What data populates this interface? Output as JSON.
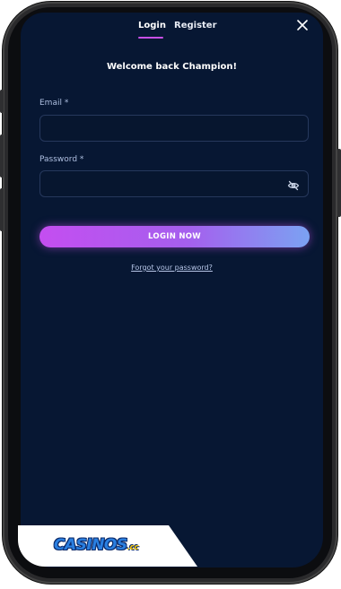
{
  "tabs": [
    {
      "label": "Login",
      "active": true
    },
    {
      "label": "Register",
      "active": false
    }
  ],
  "icons": {
    "close": "close-icon",
    "password_toggle": "eye-off-icon"
  },
  "title": "Welcome back Champion!",
  "form": {
    "email": {
      "label": "Email *",
      "value": "",
      "placeholder": ""
    },
    "password": {
      "label": "Password *",
      "value": "",
      "placeholder": ""
    },
    "submit_label": "LOGIN NOW",
    "forgot_label": "Forgot your password?"
  },
  "brand": {
    "logo_text": "CASINOS",
    "logo_tld": ".cc"
  },
  "colors": {
    "background": "#071733",
    "accent": "#c850e6",
    "button_gradient_start": "#c44ef0",
    "button_gradient_end": "#7ba2f2",
    "field_border": "#26385c",
    "label": "#aebfe0"
  }
}
